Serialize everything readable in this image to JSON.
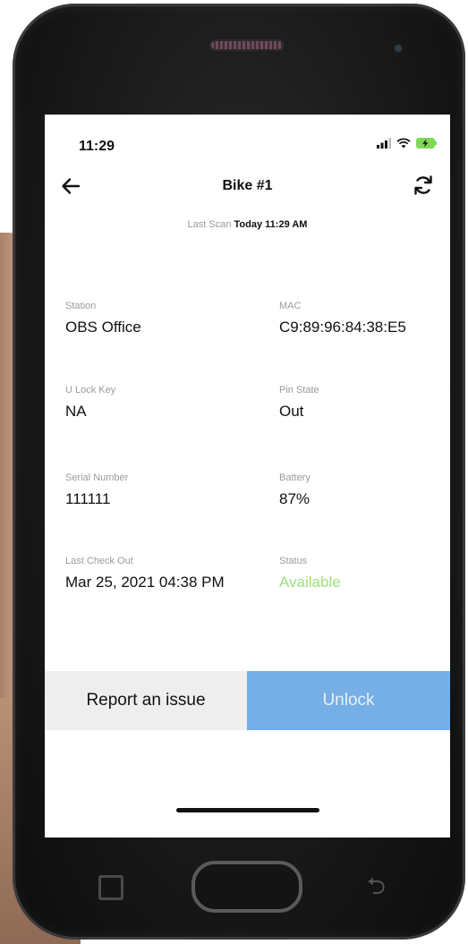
{
  "status_bar": {
    "time": "11:29"
  },
  "header": {
    "title": "Bike #1",
    "last_scan_label": "Last Scan",
    "last_scan_day": "Today",
    "last_scan_time": "11:29 AM"
  },
  "fields": {
    "station": {
      "label": "Station",
      "value": "OBS Office"
    },
    "mac": {
      "label": "MAC",
      "value": "C9:89:96:84:38:E5"
    },
    "u_lock_key": {
      "label": "U Lock Key",
      "value": "NA"
    },
    "pin_state": {
      "label": "Pin State",
      "value": "Out"
    },
    "serial_number": {
      "label": "Serial Number",
      "value": "111111"
    },
    "battery": {
      "label": "Battery",
      "value": "87%"
    },
    "last_check_out": {
      "label": "Last Check Out",
      "value": "Mar 25, 2021 04:38 PM"
    },
    "status": {
      "label": "Status",
      "value": "Available"
    }
  },
  "actions": {
    "report_label": "Report an issue",
    "unlock_label": "Unlock"
  },
  "colors": {
    "accent": "#76aee6",
    "available": "#9be07a",
    "battery_charging": "#7ed957"
  },
  "icons": {
    "back": "arrow-left-icon",
    "refresh": "refresh-icon",
    "signal": "signal-icon",
    "wifi": "wifi-icon",
    "battery": "battery-charging-icon"
  }
}
